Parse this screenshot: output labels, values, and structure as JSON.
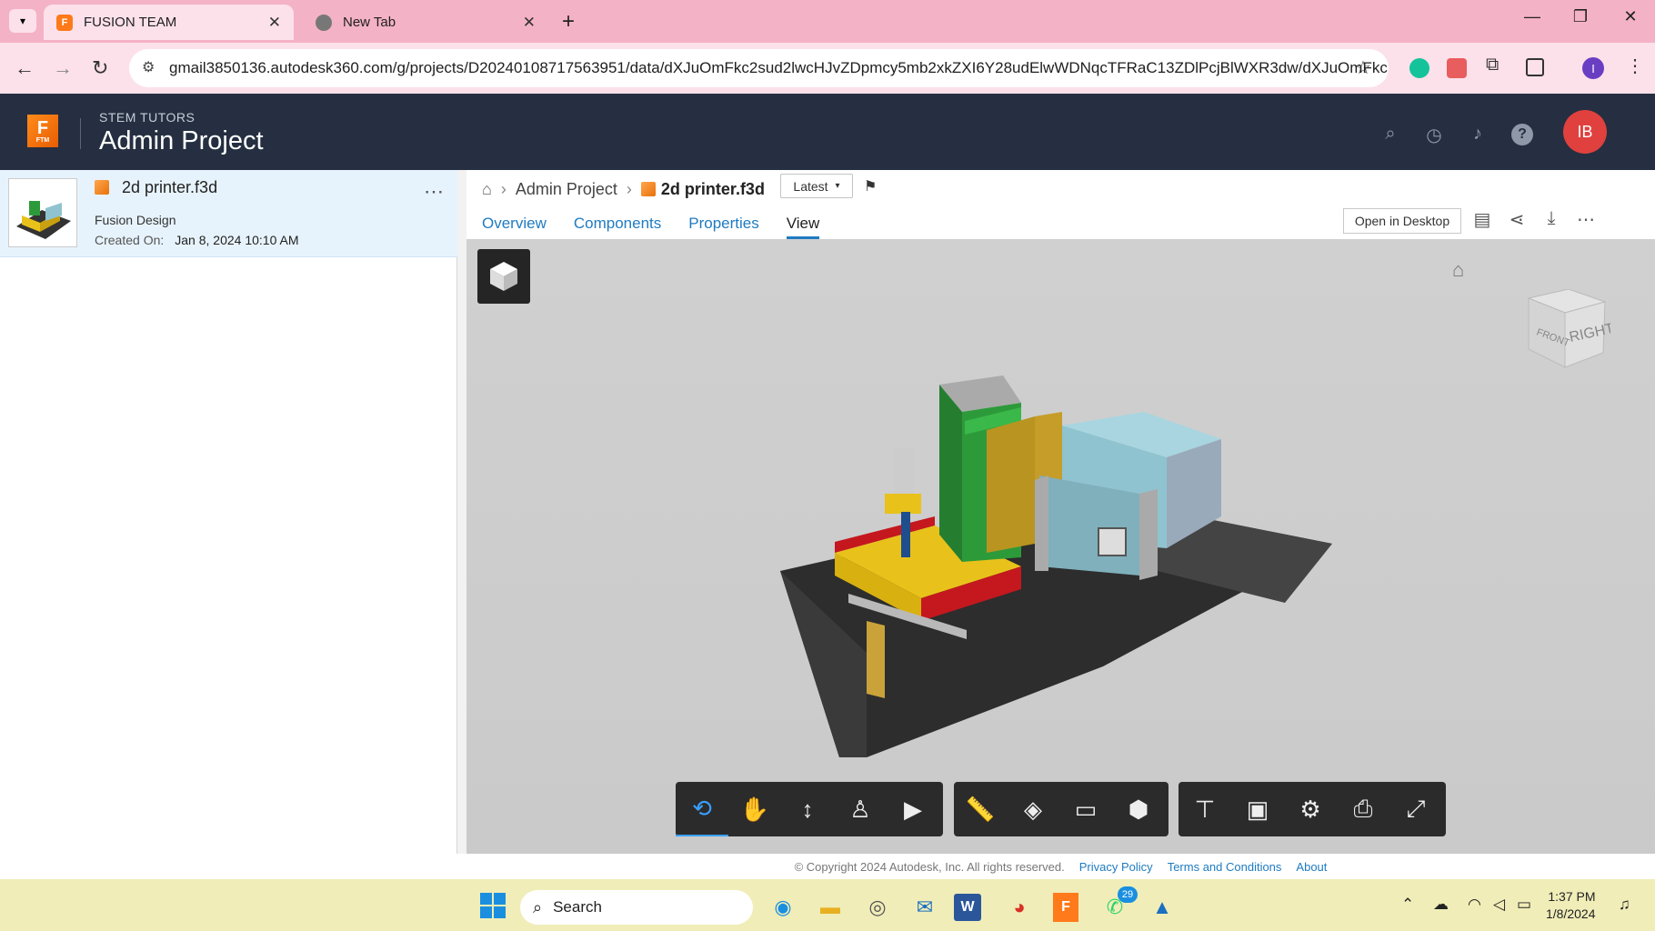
{
  "browser": {
    "tabs": [
      {
        "label": "FUSION TEAM",
        "active": true
      },
      {
        "label": "New Tab",
        "active": false
      }
    ],
    "url": "gmail3850136.autodesk360.com/g/projects/D20240108717563951/data/dXJuOmFkc2sud2lwcHJvZDpmcy5mb2xkZXI6Y28udElwWDNqcTFRaC13ZDlPcjBlWXR3dw/dXJuOmFkc2...",
    "profile_initial": "I"
  },
  "header": {
    "org": "STEM TUTORS",
    "project": "Admin Project",
    "logo_letter": "F",
    "logo_sub": "FTM",
    "avatar": "IB"
  },
  "file": {
    "name": "2d printer.f3d",
    "type": "Fusion Design",
    "created_label": "Created On:",
    "created_value": "Jan 8, 2024 10:10 AM"
  },
  "breadcrumb": {
    "project": "Admin Project",
    "file": "2d printer.f3d",
    "version": "Latest"
  },
  "tabs": [
    "Overview",
    "Components",
    "Properties",
    "View"
  ],
  "active_tab": "View",
  "toolbar": {
    "open_desktop": "Open in Desktop"
  },
  "viewcube": {
    "front": "FRONT",
    "right": "RIGHT"
  },
  "footer": {
    "copyright": "© Copyright 2024 Autodesk, Inc. All rights reserved.",
    "links": [
      "Privacy Policy",
      "Terms and Conditions",
      "About"
    ]
  },
  "taskbar": {
    "search": "Search",
    "whatsapp_badge": "29",
    "time": "1:37 PM",
    "date": "1/8/2024"
  },
  "colors": {
    "brand": "#ff8c1a",
    "header_bg": "#252f41",
    "link": "#1f7bc1",
    "avatar": "#e0413e"
  }
}
